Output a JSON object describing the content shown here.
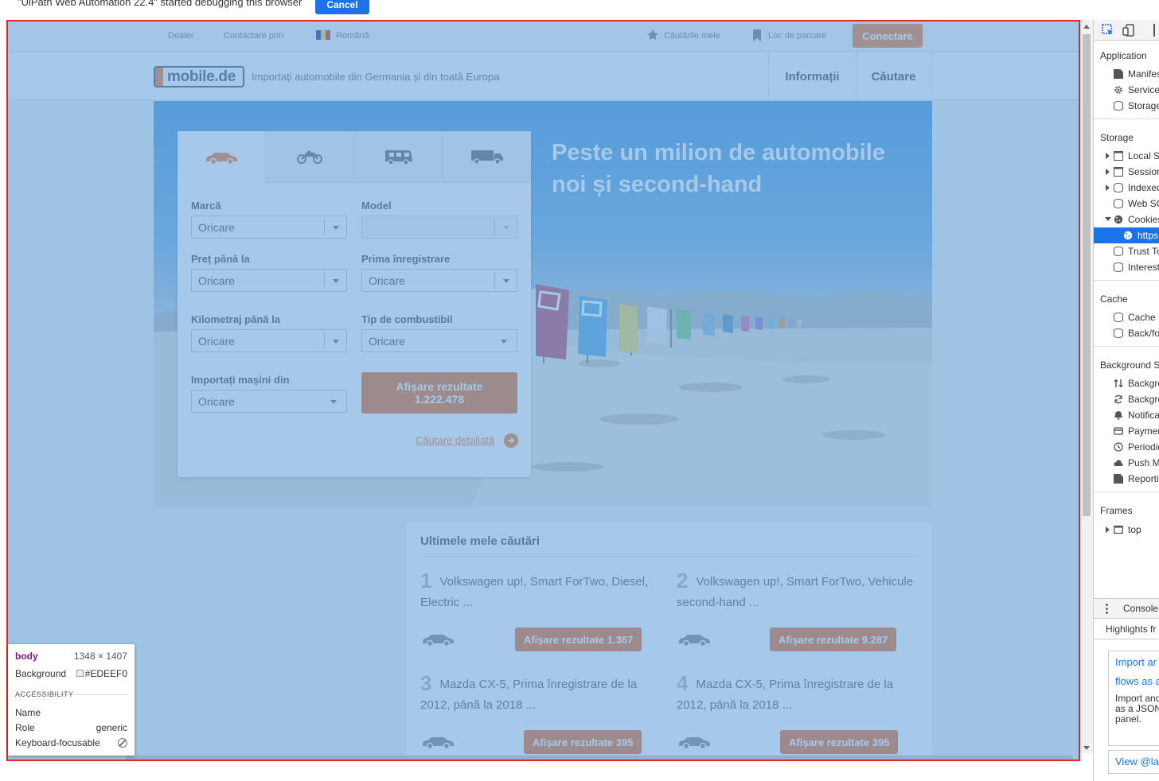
{
  "debug_banner": {
    "text": "\"UiPath Web Automation 22.4\" started debugging this browser",
    "cancel_label": "Cancel"
  },
  "topbar": {
    "dealer": "Dealer",
    "contact": "Contactare prin",
    "language": "Română",
    "saved_searches": "Căutările mele",
    "parking": "Loc de parcare",
    "connect": "Conectare"
  },
  "header": {
    "logo_text": "mobile.de",
    "tagline": "Importați automobile din Germania și din toată Europa",
    "nav": [
      "Informații",
      "Căutare"
    ]
  },
  "hero": {
    "title": "Peste un milion de automobile noi și second-hand"
  },
  "search_form": {
    "tabs": [
      "car-icon",
      "motorbike-icon",
      "motorhome-icon",
      "truck-icon"
    ],
    "make_label": "Marcă",
    "make_value": "Oricare",
    "model_label": "Model",
    "model_value": "",
    "price_label": "Preț până la",
    "price_value": "Oricare",
    "first_reg_label": "Prima înregistrare",
    "first_reg_value": "Oricare",
    "mileage_label": "Kilometraj până la",
    "mileage_value": "Oricare",
    "fuel_label": "Tip de combustibil",
    "fuel_value": "Oricare",
    "import_label": "Importați mașini din",
    "import_value": "Oricare",
    "show_results_line1": "Afișare rezultate",
    "show_results_line2": "1.222.478",
    "detailed_search": "Căutare detaliată"
  },
  "recent_searches": {
    "title": "Ultimele mele căutări",
    "items": [
      {
        "num": "1",
        "text": "Volkswagen up!, Smart ForTwo, Diesel, Electric ...",
        "button": "Afișare rezultate 1.367"
      },
      {
        "num": "2",
        "text": "Volkswagen up!, Smart ForTwo, Vehicule second-hand ...",
        "button": "Afișare rezultate 9.287"
      },
      {
        "num": "3",
        "text": "Mazda CX-5, Prima înregistrare de la 2012, până la 2018 ...",
        "button": "Afișare rezultate 395"
      },
      {
        "num": "4",
        "text": "Mazda CX-5, Prima înregistrare de la 2012, până la 2018 ...",
        "button": "Afișare rezultate 395"
      }
    ]
  },
  "inspector_tooltip": {
    "tag": "body",
    "size": "1348 × 1407",
    "background_label": "Background",
    "background_value": "#EDEEF0",
    "accessibility": "ACCESSIBILITY",
    "name_label": "Name",
    "role_label": "Role",
    "role_value": "generic",
    "focusable_label": "Keyboard-focusable"
  },
  "devtools": {
    "application_header": "Application",
    "application_items": [
      "Manifest",
      "Service",
      "Storage"
    ],
    "storage_header": "Storage",
    "storage_items": [
      "Local St",
      "Session",
      "Indexed",
      "Web SQ",
      "Cookies",
      "https",
      "Trust To",
      "Interest"
    ],
    "cache_header": "Cache",
    "cache_items": [
      "Cache S",
      "Back/fo"
    ],
    "background_header": "Background S",
    "background_items": [
      "Backgro",
      "Backgro",
      "Notifica",
      "Paymen",
      "Periodic",
      "Push M",
      "Reporti"
    ],
    "frames_header": "Frames",
    "frames_items": [
      "top"
    ],
    "console_tab": "Console",
    "highlights_tab": "Highlights fr",
    "promo_link1": "Import ar",
    "promo_link2": "flows as a",
    "promo_text": "Import and as a JSON panel.",
    "promo_link3": "View @la"
  },
  "colors": {
    "accent_orange": "#f16a1a",
    "overlay_blue": "#6fa8dc",
    "selection_border": "#e3262c",
    "devtools_selected": "#1a73e8"
  }
}
